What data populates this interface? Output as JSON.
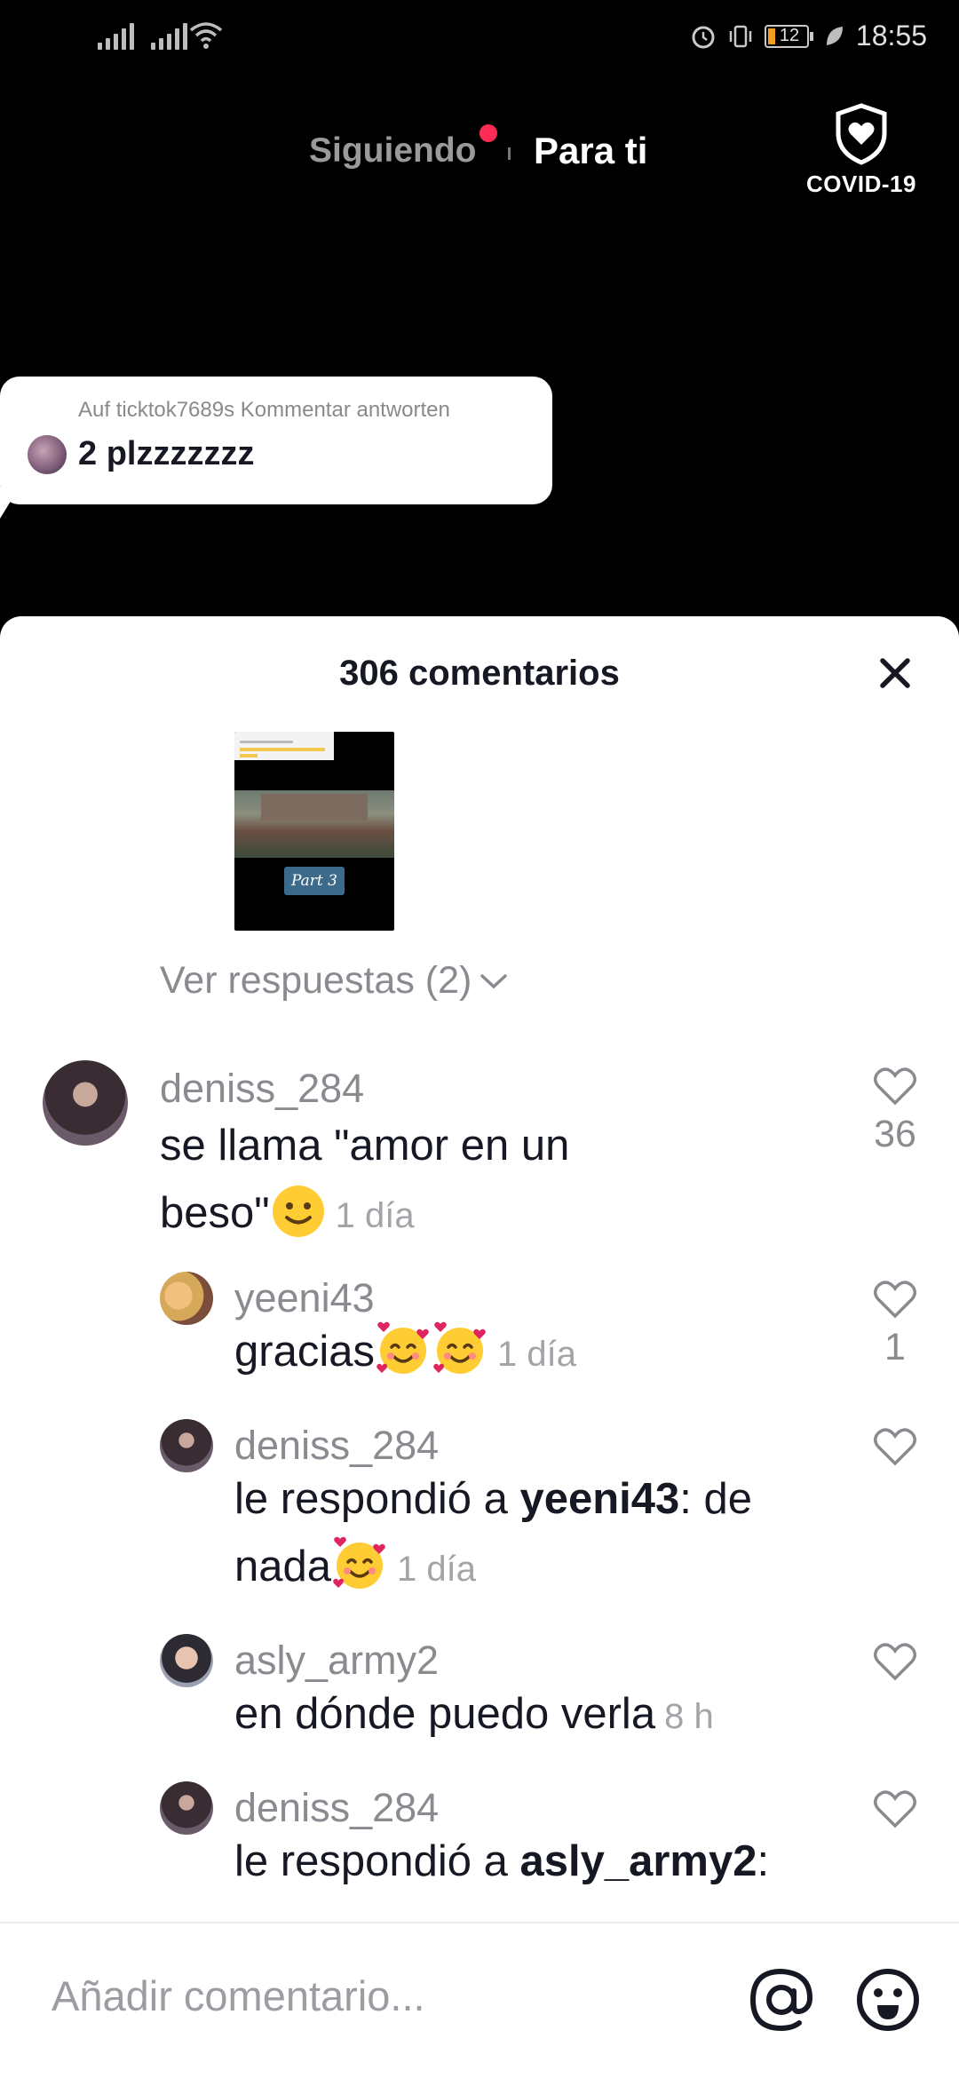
{
  "status_bar": {
    "time": "18:55",
    "battery": "12"
  },
  "nav": {
    "following": "Siguiendo",
    "for_you": "Para ti",
    "covid_label": "COVID-19"
  },
  "sticker": {
    "subtitle": "Auf ticktok7689s Kommentar antworten",
    "text": "2 plzzzzzzz"
  },
  "comments_sheet": {
    "title": "306 comentarios",
    "thumbnail_label": "Part 3",
    "view_replies": "Ver respuestas (2)",
    "comments": [
      {
        "user": "deniss_284",
        "text_line1": "se llama \"amor en un",
        "text_line2": "beso\"",
        "emoji": "slightly-smiling-face",
        "time": "1 día",
        "likes": "36"
      },
      {
        "user": "yeeni43",
        "text": "gracias",
        "emoji": "smiling-face-with-hearts",
        "time": "1 día",
        "likes": "1"
      },
      {
        "user": "deniss_284",
        "prefix": "le respondió a ",
        "mention": "yeeni43",
        "suffix": ": de",
        "text_line2": "nada",
        "emoji": "smiling-face-with-hearts",
        "time": "1 día",
        "likes": ""
      },
      {
        "user": "asly_army2",
        "text": "en dónde puedo verla",
        "time": "8 h",
        "likes": ""
      },
      {
        "user": "deniss_284",
        "prefix": "le respondió a ",
        "mention": "asly_army2",
        "suffix": ":",
        "likes": ""
      }
    ]
  },
  "composer": {
    "placeholder": "Añadir comentario..."
  },
  "colors": {
    "accent": "#fe2c55",
    "text": "#161823",
    "muted": "#8a8b91"
  }
}
